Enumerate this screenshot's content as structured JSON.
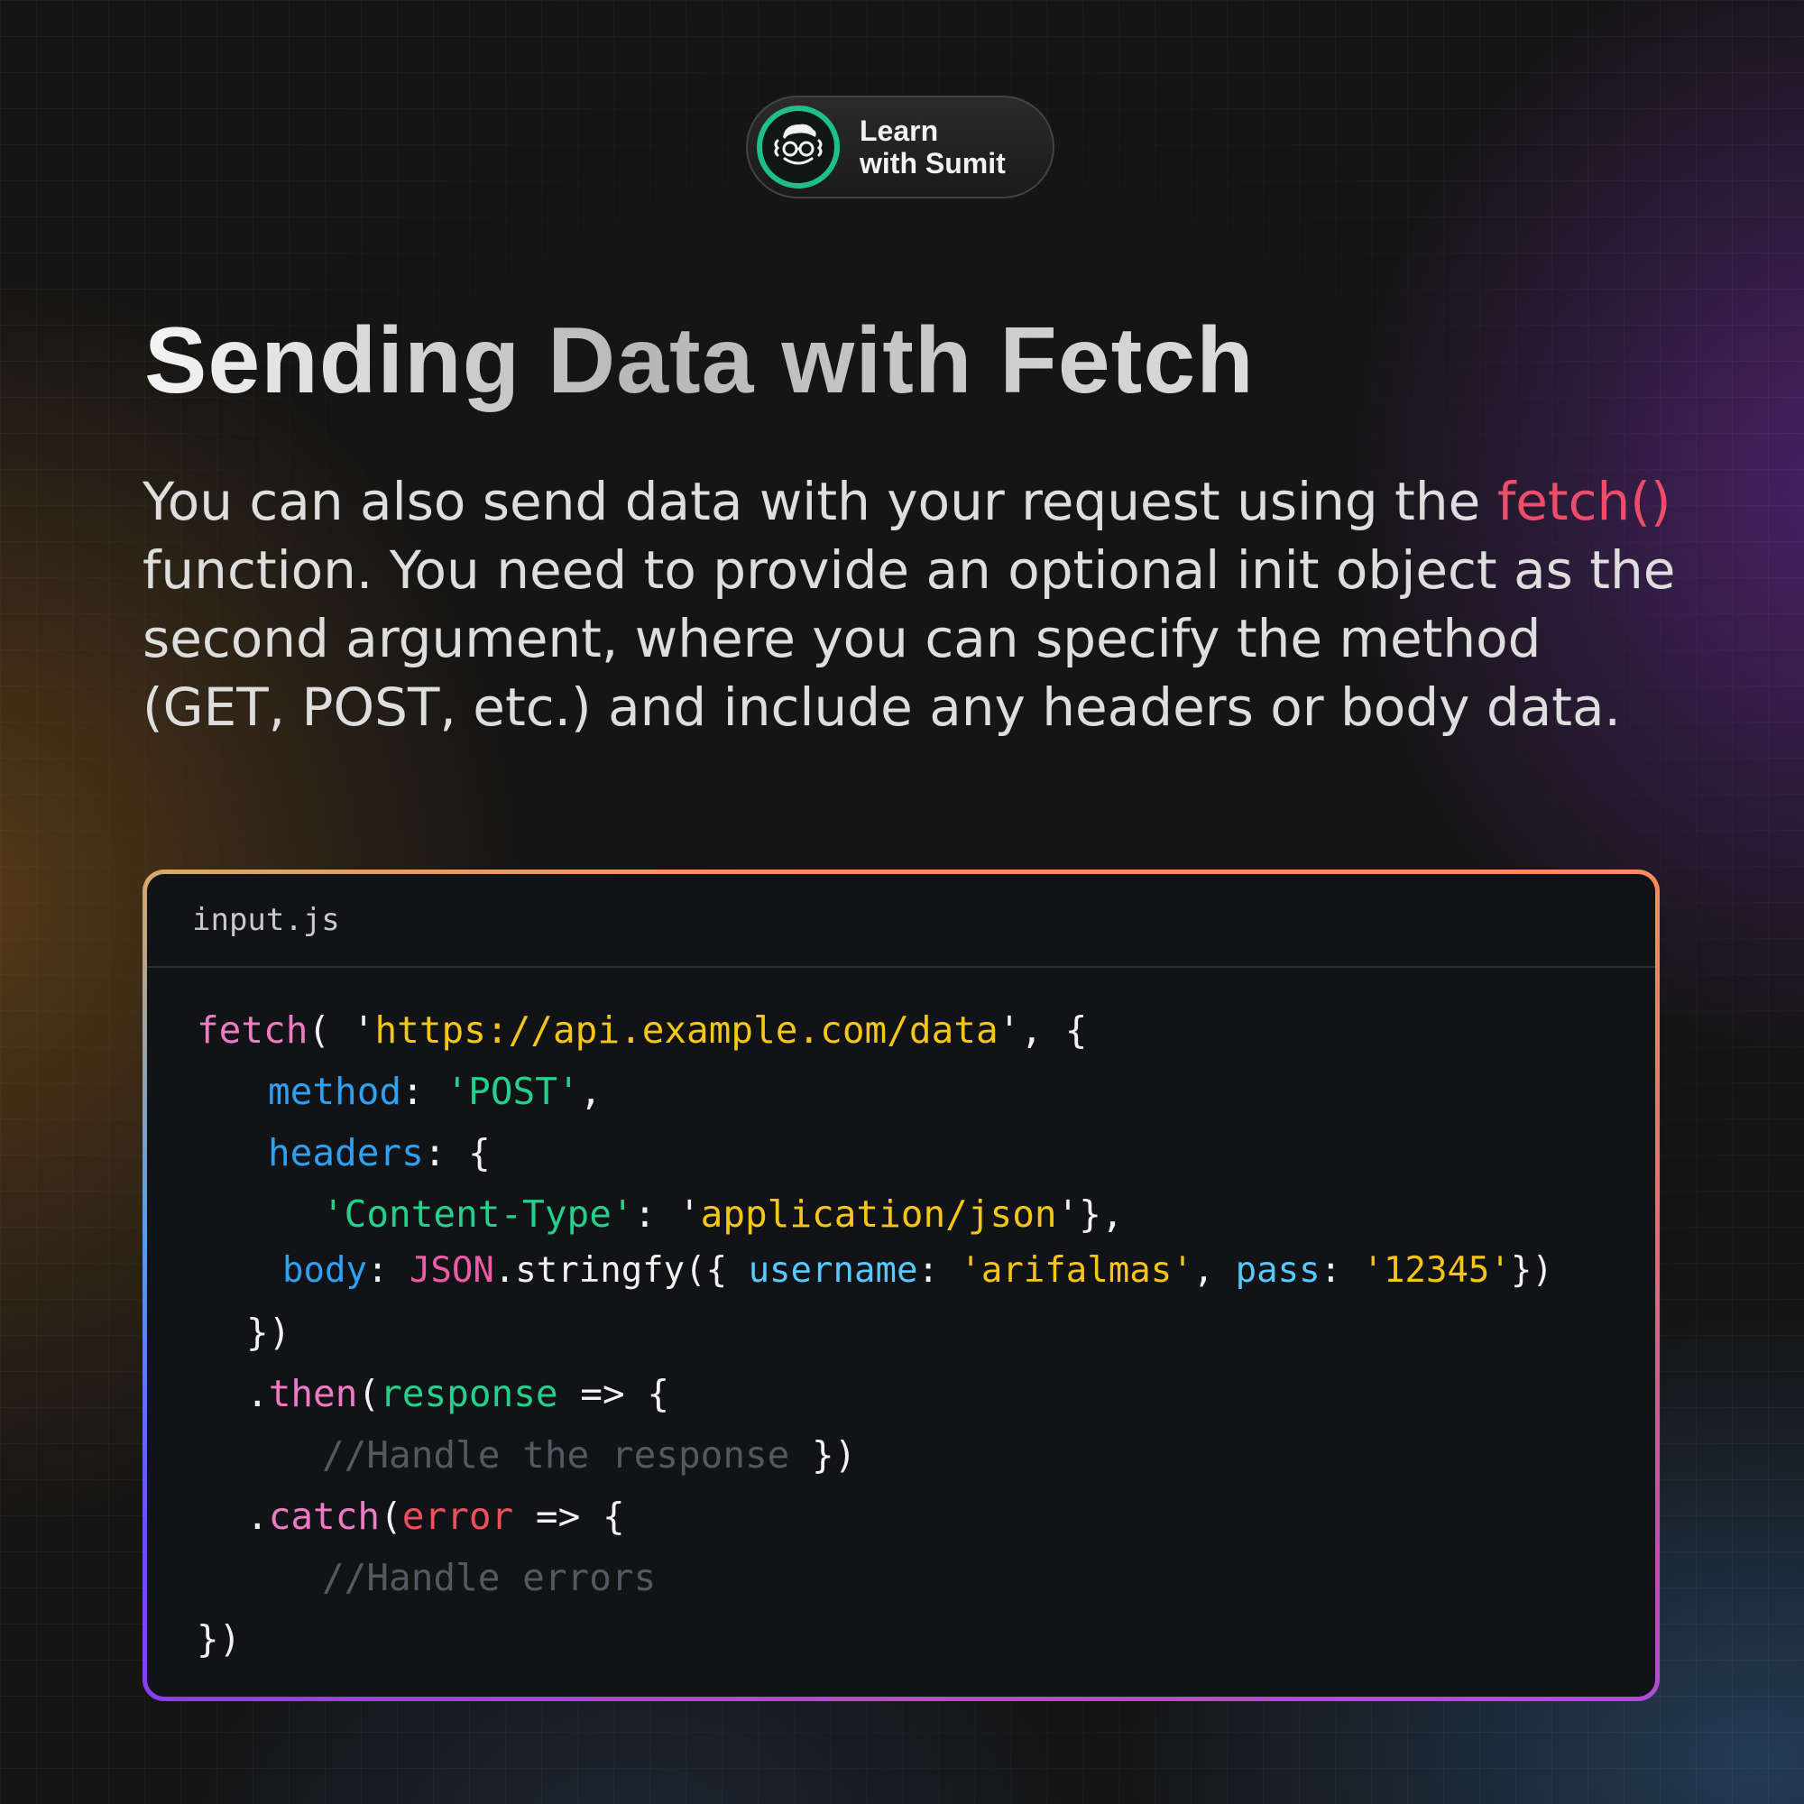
{
  "brand": {
    "line1": "Learn",
    "line2": "with Sumit"
  },
  "title": "Sending Data with Fetch",
  "description": {
    "before": "You can also send data with your request using the ",
    "highlight": "fetch()",
    "after": " function. You need to provide an optional init object as the second argument, where you can specify the method (GET, POST, etc.) and include any headers or body data."
  },
  "code_card": {
    "filename": "input.js",
    "lines": {
      "l1": {
        "a": "fetch",
        "b": "( '",
        "c": "https://api.example.com/data",
        "d": "', {"
      },
      "l2": {
        "a": "method",
        "b": ": ",
        "c": "'POST'",
        "d": ","
      },
      "l3": {
        "a": "headers",
        "b": ": {"
      },
      "l4": {
        "a": "'Content-Type'",
        "b": ": '",
        "c": "application/json",
        "d": "'},"
      },
      "l5": {
        "a": "body",
        "b": ": ",
        "c": "JSON",
        "d": ".stringfy({ ",
        "e": "username",
        "f": ": ",
        "g": "'arifalmas'",
        "h": ", ",
        "i": "pass",
        "j": ": ",
        "k": "'12345'",
        "l": "})"
      },
      "l6": {
        "a": "})"
      },
      "l7": {
        "a": ".",
        "b": "then",
        "c": "(",
        "d": "response",
        "e": " => {"
      },
      "l8": {
        "a": "//Handle the response",
        "b": " })"
      },
      "l9": {
        "a": ".",
        "b": "catch",
        "c": "(",
        "d": "error",
        "e": " => {"
      },
      "l10": {
        "a": "//Handle errors"
      },
      "l11": {
        "a": "})"
      }
    }
  },
  "colors": {
    "accent_fetch": "#ee4d6a",
    "logo_ring": "#1fbf8a",
    "code_string": "#f5c518",
    "code_key": "#2fa0f2",
    "code_green": "#24d08c",
    "code_function": "#f07ac4",
    "code_comment": "#555860"
  },
  "icons": {
    "brand_logo": "developer-face-with-glasses-icon"
  }
}
